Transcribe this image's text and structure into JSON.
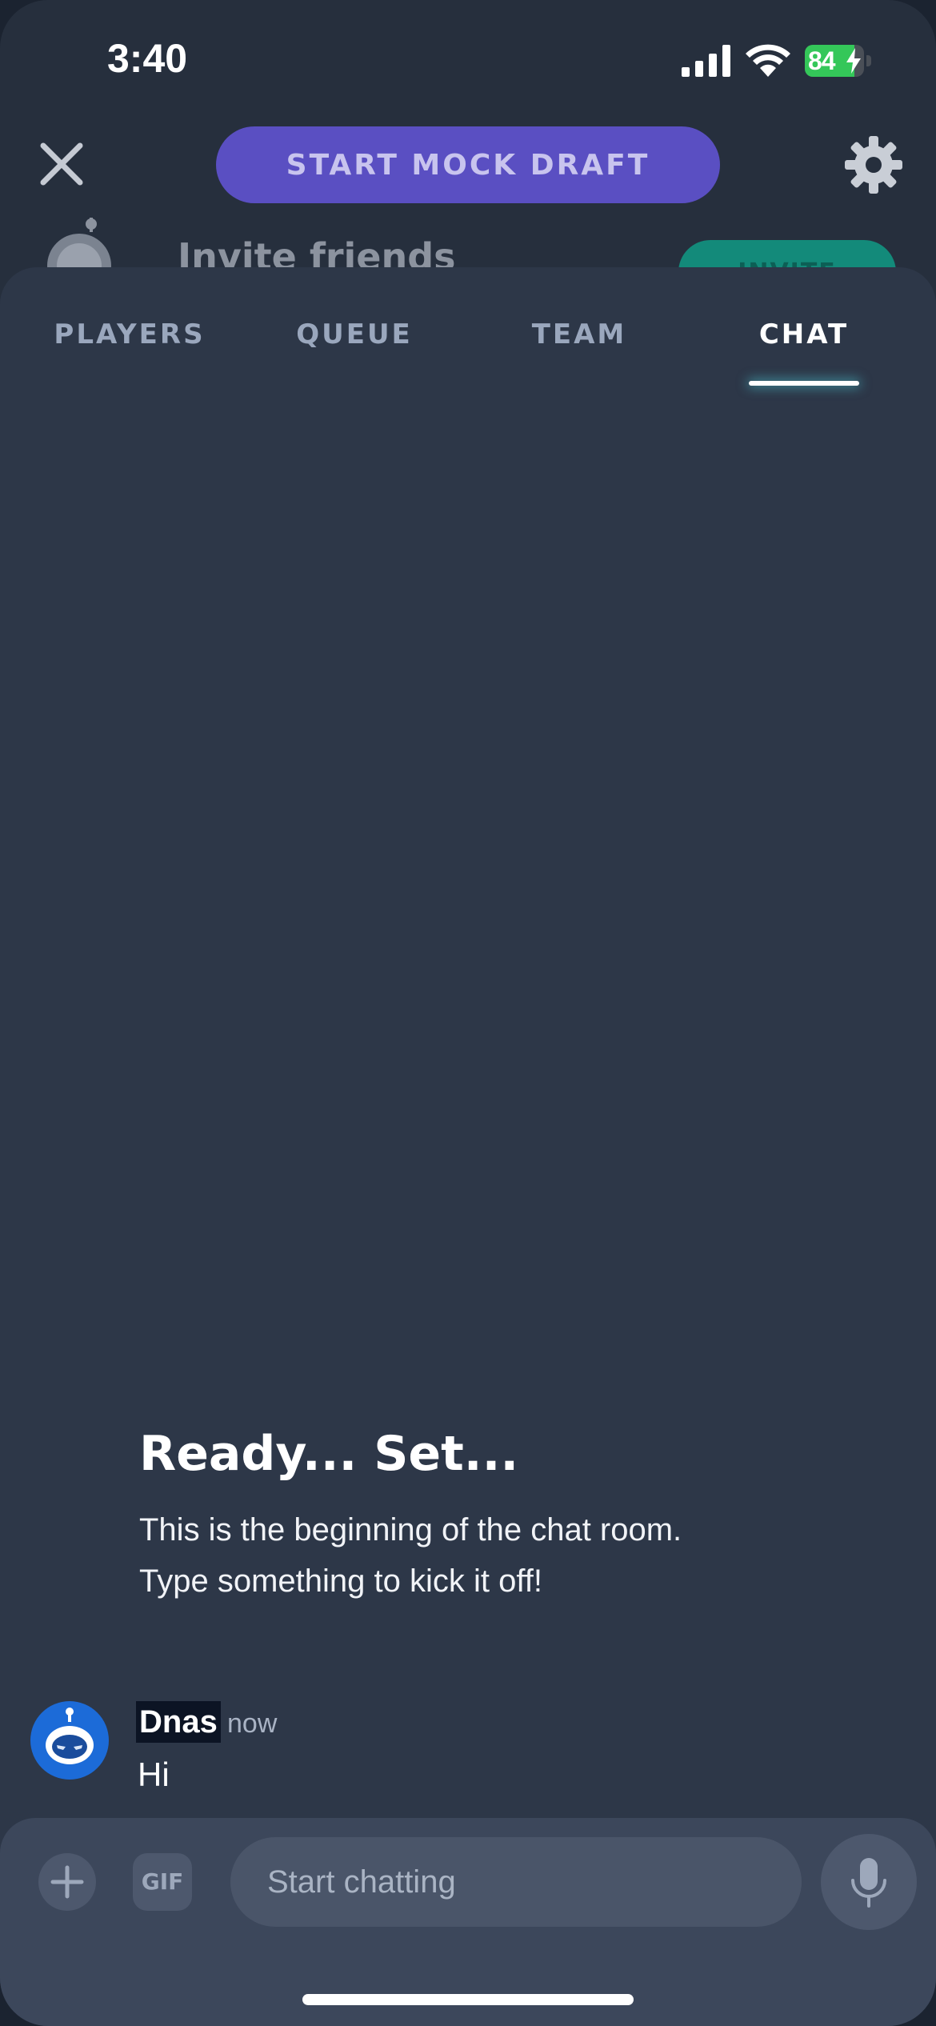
{
  "status_bar": {
    "time": "3:40",
    "battery_percent": "84",
    "battery_level": 0.84,
    "icons": [
      "signal-icon",
      "wifi-icon",
      "battery-icon"
    ]
  },
  "header": {
    "start_mock_draft_label": "START MOCK DRAFT",
    "close_icon": "close-icon",
    "settings_icon": "gear-icon"
  },
  "invite": {
    "label": "Invite friends",
    "button_label": "INVITE"
  },
  "tabs": [
    {
      "label": "PLAYERS",
      "active": false
    },
    {
      "label": "QUEUE",
      "active": false
    },
    {
      "label": "TEAM",
      "active": false
    },
    {
      "label": "CHAT",
      "active": true
    }
  ],
  "chat": {
    "empty_heading": "Ready... Set...",
    "empty_text_line1": "This is the beginning of the chat room.",
    "empty_text_line2": "Type something to kick it off!",
    "messages": [
      {
        "author": "Dnas",
        "time": "now",
        "text": "Hi"
      }
    ]
  },
  "composer": {
    "placeholder": "Start chatting",
    "gif_label": "GIF",
    "add_icon": "plus-icon",
    "mic_icon": "microphone-icon"
  },
  "colors": {
    "accent_purple": "#5a4fc2",
    "tab_indicator": "#ffffff",
    "invite_green": "#138a7a",
    "battery_green": "#34c759"
  }
}
